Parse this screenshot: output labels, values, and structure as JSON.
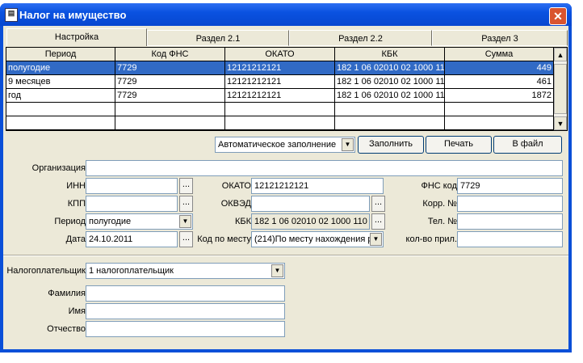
{
  "window": {
    "title": "Налог на имущество",
    "close": "✕"
  },
  "tabs": [
    "Настройка",
    "Раздел 2.1",
    "Раздел 2.2",
    "Раздел 3"
  ],
  "grid": {
    "headers": [
      "Период",
      "Код ФНС",
      "ОКАТО",
      "КБК",
      "Сумма"
    ],
    "rows": [
      [
        "полугодие",
        "7729",
        "12121212121",
        "182 1 06 02010 02 1000 11",
        "449"
      ],
      [
        "9 месяцев",
        "7729",
        "12121212121",
        "182 1 06 02010 02 1000 11",
        "461"
      ],
      [
        "год",
        "7729",
        "12121212121",
        "182 1 06 02010 02 1000 11",
        "1872"
      ]
    ]
  },
  "toolbar": {
    "mode": "Автоматическое заполнение",
    "fill": "Заполнить",
    "print": "Печать",
    "to_file": "В файл"
  },
  "form": {
    "org_label": "Организация",
    "inn_label": "ИНН",
    "kpp_label": "КПП",
    "period_label": "Период",
    "period": "полугодие",
    "date_label": "Дата",
    "date": "24.10.2011",
    "okato_label": "ОКАТО",
    "okato": "12121212121",
    "okved_label": "ОКВЭД",
    "kbk_label": "КБК",
    "kbk": "182 1 06 02010 02 1000 110",
    "place_label": "Код по месту",
    "place": "(214)По месту нахождения р",
    "fns_label": "ФНС код",
    "fns": "7729",
    "corr_label": "Корр. №",
    "tel_label": "Тел. №",
    "att_label": "кол-во прил.",
    "ellipsis": "..."
  },
  "payer": {
    "label": "Налогоплательщик",
    "value": "1 налогоплательщик",
    "surname_label": "Фамилия",
    "name_label": "Имя",
    "patronymic_label": "Отчество"
  }
}
